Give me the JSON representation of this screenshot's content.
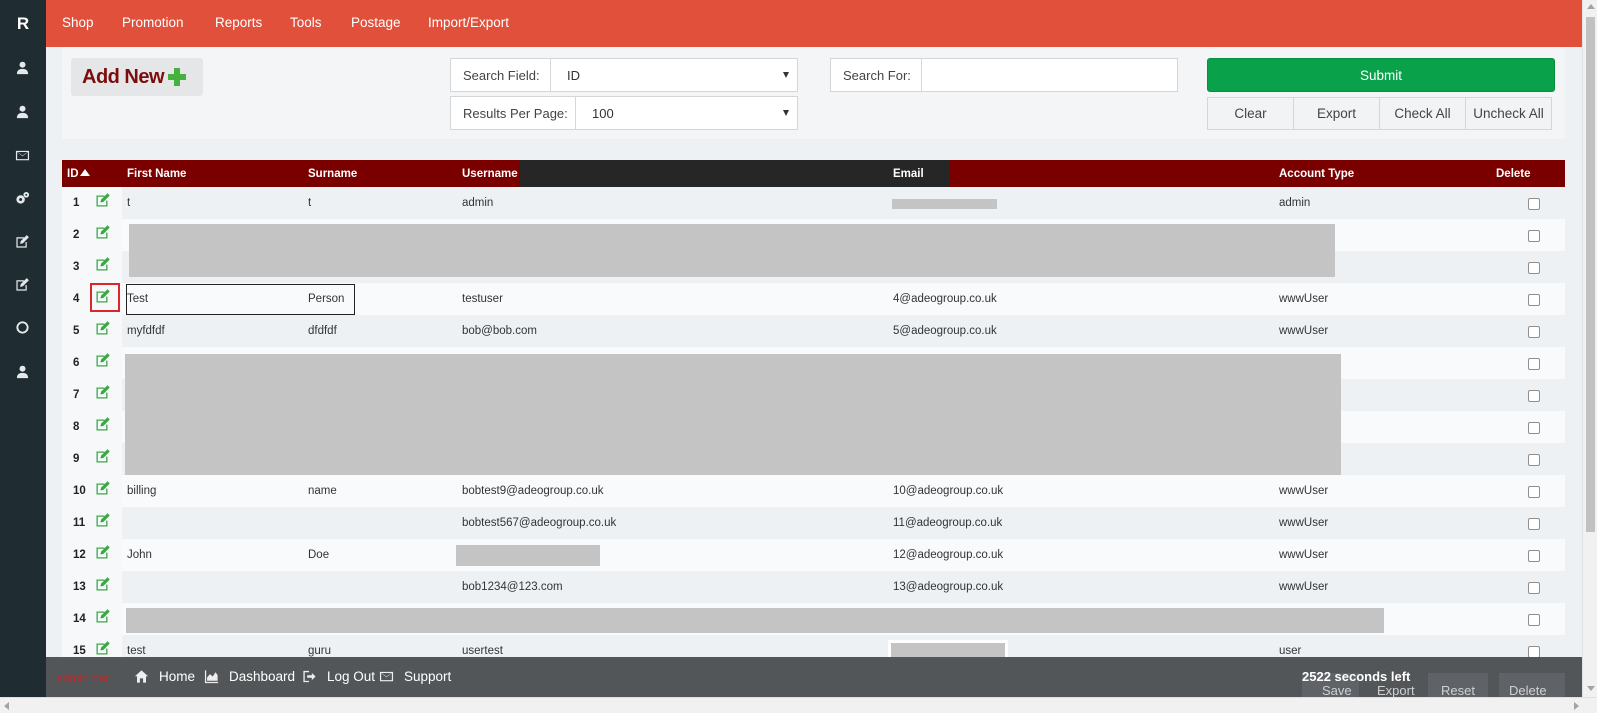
{
  "sidebar": {
    "logo": "R",
    "icons": [
      "user-icon",
      "user-icon",
      "envelope-icon",
      "gears-icon",
      "edit-icon",
      "edit-icon",
      "circle-icon",
      "user-icon"
    ]
  },
  "nav": {
    "items": [
      {
        "label": "Shop"
      },
      {
        "label": "Promotion"
      },
      {
        "label": "Reports"
      },
      {
        "label": "Tools"
      },
      {
        "label": "Postage"
      },
      {
        "label": "Import/Export"
      }
    ]
  },
  "toolbar": {
    "add_new": "Add New",
    "search_field_label": "Search Field:",
    "search_field_value": "ID",
    "results_per_page_label": "Results Per Page:",
    "results_per_page_value": "100",
    "search_for_label": "Search For:",
    "search_for_value": "",
    "submit": "Submit",
    "clear": "Clear",
    "export": "Export",
    "check_all": "Check All",
    "uncheck_all": "Uncheck All"
  },
  "table": {
    "headers": {
      "id": "ID",
      "first_name": "First Name",
      "surname": "Surname",
      "username": "Username",
      "email": "Email",
      "account_type": "Account Type",
      "delete": "Delete"
    },
    "rows": [
      {
        "id": "1",
        "first": "t",
        "surname": "t",
        "username": "admin",
        "email": "",
        "type": "admin"
      },
      {
        "id": "2",
        "first": "",
        "surname": "",
        "username": "",
        "email": "",
        "type": ""
      },
      {
        "id": "3",
        "first": "",
        "surname": "",
        "username": "",
        "email": "",
        "type": ""
      },
      {
        "id": "4",
        "first": "Test",
        "surname": "Person",
        "username": "testuser",
        "email": "4@adeogroup.co.uk",
        "type": "wwwUser"
      },
      {
        "id": "5",
        "first": "myfdfdf",
        "surname": "dfdfdf",
        "username": "bob@bob.com",
        "email": "5@adeogroup.co.uk",
        "type": "wwwUser"
      },
      {
        "id": "6",
        "first": "",
        "surname": "",
        "username": "",
        "email": "",
        "type": ""
      },
      {
        "id": "7",
        "first": "",
        "surname": "",
        "username": "",
        "email": "",
        "type": ""
      },
      {
        "id": "8",
        "first": "",
        "surname": "",
        "username": "",
        "email": "",
        "type": ""
      },
      {
        "id": "9",
        "first": "",
        "surname": "",
        "username": "",
        "email": "",
        "type": ""
      },
      {
        "id": "10",
        "first": "billing",
        "surname": "name",
        "username": "bobtest9@adeogroup.co.uk",
        "email": "10@adeogroup.co.uk",
        "type": "wwwUser"
      },
      {
        "id": "11",
        "first": "",
        "surname": "",
        "username": "bobtest567@adeogroup.co.uk",
        "email": "11@adeogroup.co.uk",
        "type": "wwwUser"
      },
      {
        "id": "12",
        "first": "John",
        "surname": "Doe",
        "username": "",
        "email": "12@adeogroup.co.uk",
        "type": "wwwUser"
      },
      {
        "id": "13",
        "first": "",
        "surname": "",
        "username": "bob1234@123.com",
        "email": "13@adeogroup.co.uk",
        "type": "wwwUser"
      },
      {
        "id": "14",
        "first": "",
        "surname": "",
        "username": "",
        "email": "",
        "type": ""
      },
      {
        "id": "15",
        "first": "test",
        "surname": "guru",
        "username": "usertest",
        "email": "",
        "type": "user"
      }
    ]
  },
  "footer": {
    "admin_label": "admin bar",
    "home": "Home",
    "dashboard": "Dashboard",
    "logout": "Log Out",
    "support": "Support",
    "timer": "2522 seconds left",
    "save": "Save",
    "export": "Export",
    "reset": "Reset",
    "delete": "Delete"
  },
  "colors": {
    "nav": "#e0503b",
    "sidebar": "#1f2d33",
    "table_header": "#7a0000",
    "submit": "#0aa14b",
    "footer": "#525659"
  }
}
